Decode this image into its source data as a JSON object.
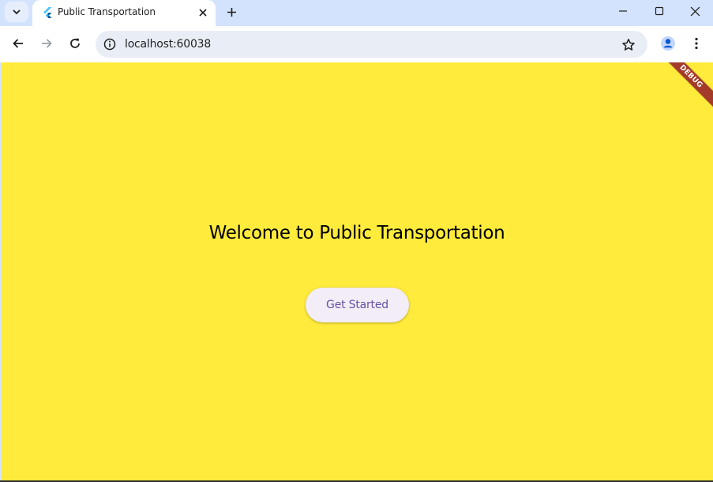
{
  "browser": {
    "tab": {
      "title": "Public Transportation",
      "favicon": "flutter-icon"
    },
    "address": {
      "url": "localhost:60038"
    },
    "icons": {
      "tab_search": "chevron-down-icon",
      "tab_close": "close-icon",
      "new_tab": "plus-icon",
      "minimize": "minimize-icon",
      "maximize": "maximize-icon",
      "close_window": "close-icon",
      "back": "arrow-left-icon",
      "forward": "arrow-right-icon",
      "reload": "reload-icon",
      "site_info": "info-icon",
      "bookmark": "star-icon",
      "profile": "person-icon",
      "menu": "kebab-menu-icon"
    }
  },
  "app": {
    "heading": "Welcome to Public Transportation",
    "cta_label": "Get Started",
    "debug_banner": "DEBUG"
  },
  "colors": {
    "background": "#ffeb3b",
    "button_bg": "#f3edf7",
    "button_text": "#6750a4",
    "debug_banner": "#a33a2a",
    "browser_frame": "#d3e3fd"
  }
}
